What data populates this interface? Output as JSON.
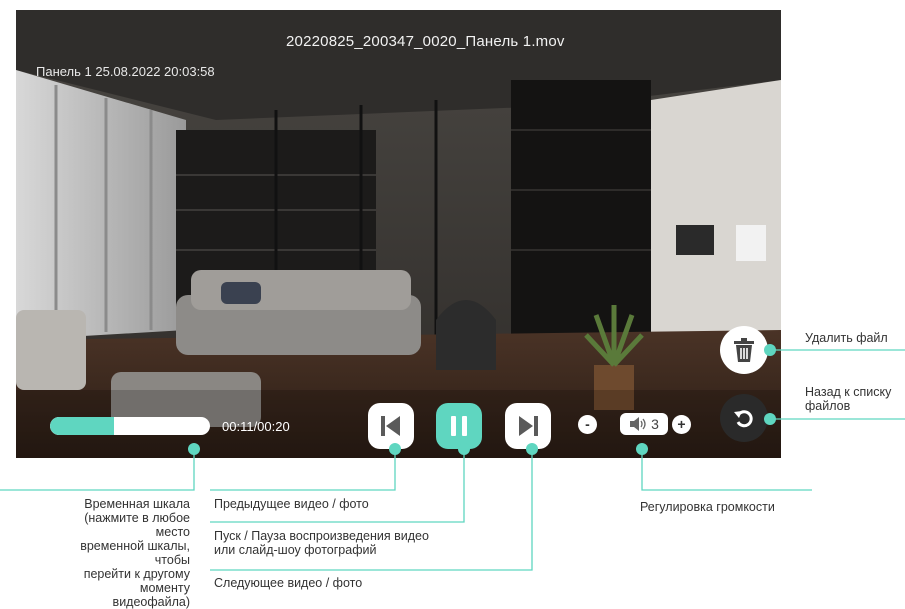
{
  "player": {
    "file_name": "20220825_200347_0020_Панель 1.mov",
    "stamp": "Панель 1 25.08.2022 20:03:58",
    "progress": 0.4,
    "time": "00:11/00:20",
    "volume_minus": "-",
    "volume_level": "3",
    "volume_plus": "+"
  },
  "icons": {
    "prev": "skip-previous-icon",
    "pause": "pause-icon",
    "next": "skip-next-icon",
    "speaker": "speaker-icon",
    "delete": "trash-icon",
    "back": "undo-arrow-icon"
  },
  "callouts": {
    "delete": "Удалить файл",
    "back_line1": "Назад к списку",
    "back_line2": "файлов",
    "timeline_lines": [
      "Временная шкала",
      "(нажмите в любое место",
      "временной шкалы, чтобы",
      "перейти к другому моменту",
      "видеофайла)"
    ],
    "prev": "Предыдущее видео / фото",
    "pause_line1": "Пуск / Пауза воспроизведения видео",
    "pause_line2": "или слайд-шоу фотографий",
    "next": "Следующее видео / фото",
    "volume": "Регулировка громкости"
  },
  "colors": {
    "accent": "#5fd6c0",
    "button_bg": "#ffffff",
    "back_button_bg": "#2a2a2a"
  }
}
